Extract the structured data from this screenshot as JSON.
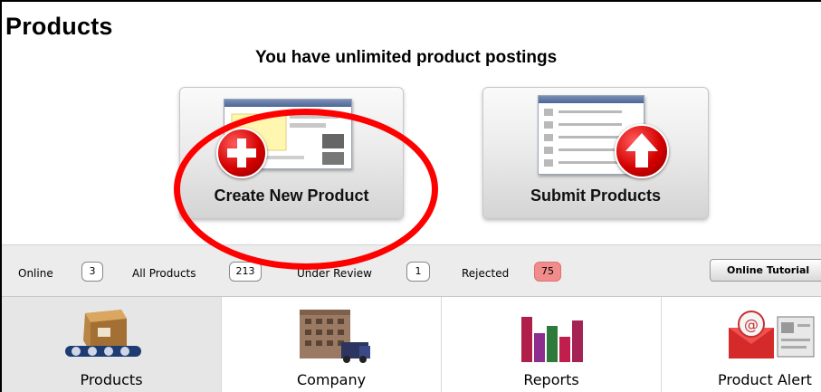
{
  "header": {
    "title": "Products",
    "quota_message": "You have unlimited product postings"
  },
  "actions": {
    "create_label": "Create New Product",
    "submit_label": "Submit Products"
  },
  "stats": {
    "online_label": "Online",
    "online_count": "3",
    "all_label": "All Products",
    "all_count": "213",
    "review_label": "Under Review",
    "review_count": "1",
    "rejected_label": "Rejected",
    "rejected_count": "75",
    "tutorial_label": "Online Tutorial",
    "rejected_color": "#f08c8c"
  },
  "tabs": [
    {
      "label": "Products",
      "icon": "boxes-icon"
    },
    {
      "label": "Company",
      "icon": "building-icon"
    },
    {
      "label": "Reports",
      "icon": "bar-chart-icon"
    },
    {
      "label": "Product Alert",
      "icon": "email-alert-icon"
    }
  ],
  "annotation": {
    "color": "#ff0000"
  }
}
